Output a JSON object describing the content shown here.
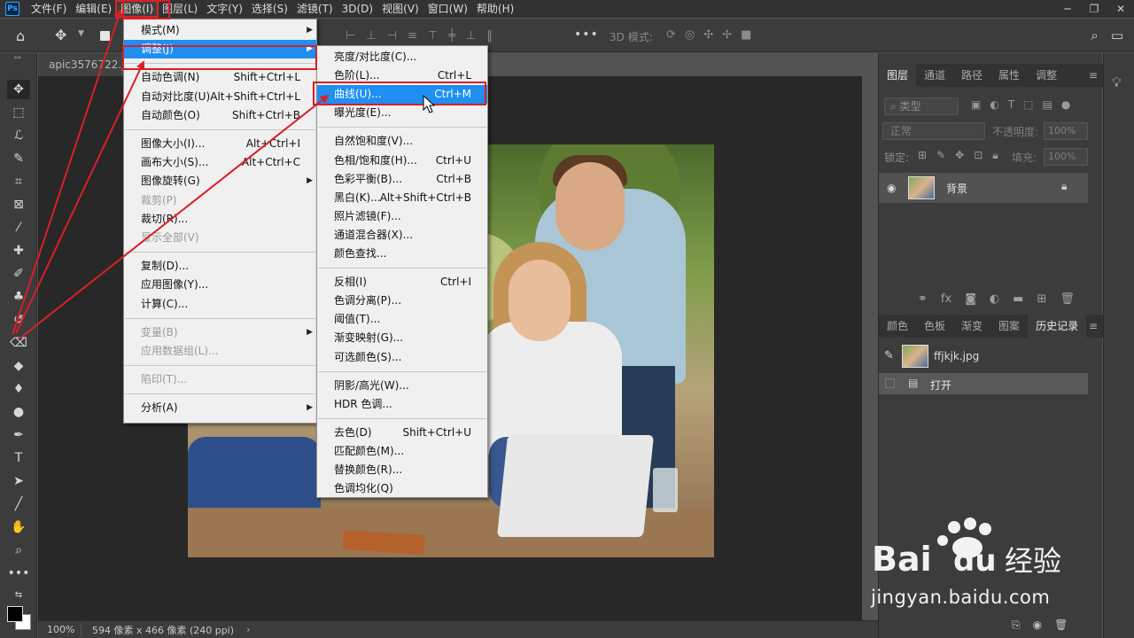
{
  "app": {
    "logo": "Ps"
  },
  "menubar": {
    "items": [
      "文件(F)",
      "编辑(E)",
      "图像(I)",
      "图层(L)",
      "文字(Y)",
      "选择(S)",
      "滤镜(T)",
      "3D(D)",
      "视图(V)",
      "窗口(W)",
      "帮助(H)"
    ],
    "active_index": 2
  },
  "window_controls": [
    "minimize-icon",
    "restore-icon",
    "close-icon"
  ],
  "options_bar": {
    "mode_3d_label": "3D 模式:",
    "more_label": "•••"
  },
  "document": {
    "tab_title": "apic3576722.jp",
    "zoom": "100%",
    "info": "594 像素 x 466 像素 (240 ppi)",
    "info_arrow": "›"
  },
  "image_menu": {
    "items": [
      {
        "label": "模式(M)",
        "submenu": true
      },
      {
        "label": "调整(J)",
        "submenu": true,
        "highlighted": true
      },
      {
        "label": "自动色调(N)",
        "shortcut": "Shift+Ctrl+L"
      },
      {
        "label": "自动对比度(U)",
        "shortcut": "Alt+Shift+Ctrl+L"
      },
      {
        "label": "自动颜色(O)",
        "shortcut": "Shift+Ctrl+B"
      },
      {
        "label": "图像大小(I)...",
        "shortcut": "Alt+Ctrl+I"
      },
      {
        "label": "画布大小(S)...",
        "shortcut": "Alt+Ctrl+C"
      },
      {
        "label": "图像旋转(G)",
        "submenu": true
      },
      {
        "label": "裁剪(P)",
        "disabled": true
      },
      {
        "label": "裁切(R)..."
      },
      {
        "label": "显示全部(V)",
        "disabled": true
      },
      {
        "label": "复制(D)..."
      },
      {
        "label": "应用图像(Y)..."
      },
      {
        "label": "计算(C)..."
      },
      {
        "label": "变量(B)",
        "submenu": true,
        "disabled": true
      },
      {
        "label": "应用数据组(L)...",
        "disabled": true
      },
      {
        "label": "陷印(T)...",
        "disabled": true
      },
      {
        "label": "分析(A)",
        "submenu": true
      }
    ]
  },
  "adjust_menu": {
    "items": [
      {
        "label": "亮度/对比度(C)..."
      },
      {
        "label": "色阶(L)...",
        "shortcut": "Ctrl+L"
      },
      {
        "label": "曲线(U)...",
        "shortcut": "Ctrl+M",
        "highlighted": true
      },
      {
        "label": "曝光度(E)..."
      },
      {
        "label": "自然饱和度(V)..."
      },
      {
        "label": "色相/饱和度(H)...",
        "shortcut": "Ctrl+U"
      },
      {
        "label": "色彩平衡(B)...",
        "shortcut": "Ctrl+B"
      },
      {
        "label": "黑白(K)...",
        "shortcut": "Alt+Shift+Ctrl+B"
      },
      {
        "label": "照片滤镜(F)..."
      },
      {
        "label": "通道混合器(X)..."
      },
      {
        "label": "颜色查找..."
      },
      {
        "label": "反相(I)",
        "shortcut": "Ctrl+I"
      },
      {
        "label": "色调分离(P)..."
      },
      {
        "label": "阈值(T)..."
      },
      {
        "label": "渐变映射(G)..."
      },
      {
        "label": "可选颜色(S)..."
      },
      {
        "label": "阴影/高光(W)..."
      },
      {
        "label": "HDR 色调..."
      },
      {
        "label": "去色(D)",
        "shortcut": "Shift+Ctrl+U"
      },
      {
        "label": "匹配颜色(M)..."
      },
      {
        "label": "替换颜色(R)..."
      },
      {
        "label": "色调均化(Q)"
      }
    ]
  },
  "layers_panel": {
    "tabs": [
      "图层",
      "通道",
      "路径",
      "属性",
      "调整"
    ],
    "active_tab": 0,
    "filter_placeholder": "类型",
    "blend_mode": "正常",
    "opacity_label": "不透明度:",
    "opacity_value": "100%",
    "lock_label": "锁定:",
    "fill_label": "填充:",
    "fill_value": "100%",
    "layers": [
      {
        "name": "背景",
        "visible": true,
        "locked": true
      }
    ]
  },
  "history_panel": {
    "tabs": [
      "颜色",
      "色板",
      "渐变",
      "图案",
      "历史记录"
    ],
    "active_tab": 4,
    "snapshot": "ffjkjk.jpg",
    "steps": [
      "打开"
    ]
  },
  "watermark": {
    "brand": "Bai",
    "brand_suffix": "经验",
    "url": "jingyan.baidu.com"
  },
  "colors": {
    "accent_highlight": "#1f8ff2",
    "annotation_red": "#d91f26",
    "panel_bg": "#3c3c3c",
    "canvas_bg": "#282828"
  }
}
